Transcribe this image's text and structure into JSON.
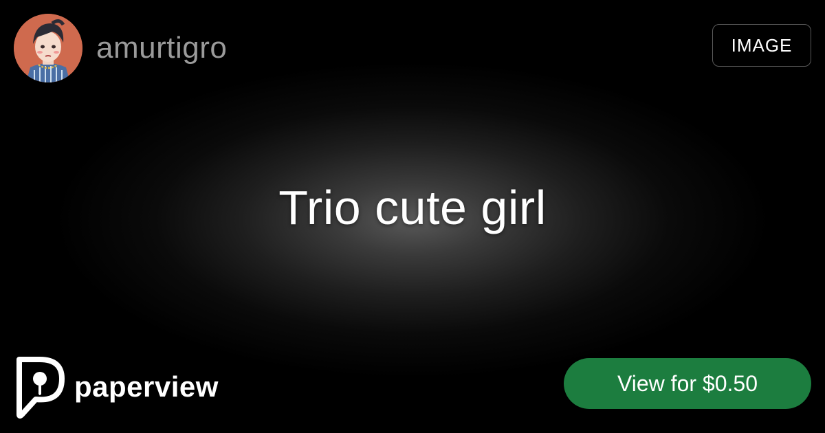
{
  "creator": {
    "username": "amurtigro",
    "avatar_icon": "user-avatar-illustration"
  },
  "badge": {
    "label": "IMAGE"
  },
  "post": {
    "title": "Trio cute girl"
  },
  "brand": {
    "name": "paperview",
    "logo_icon": "paperview-logo-icon"
  },
  "cta": {
    "label": "View for $0.50"
  },
  "colors": {
    "background": "#000000",
    "accent_green": "#1c7d3f",
    "username_gray": "#9a9a9a",
    "avatar_bg": "#cf6a4e"
  }
}
